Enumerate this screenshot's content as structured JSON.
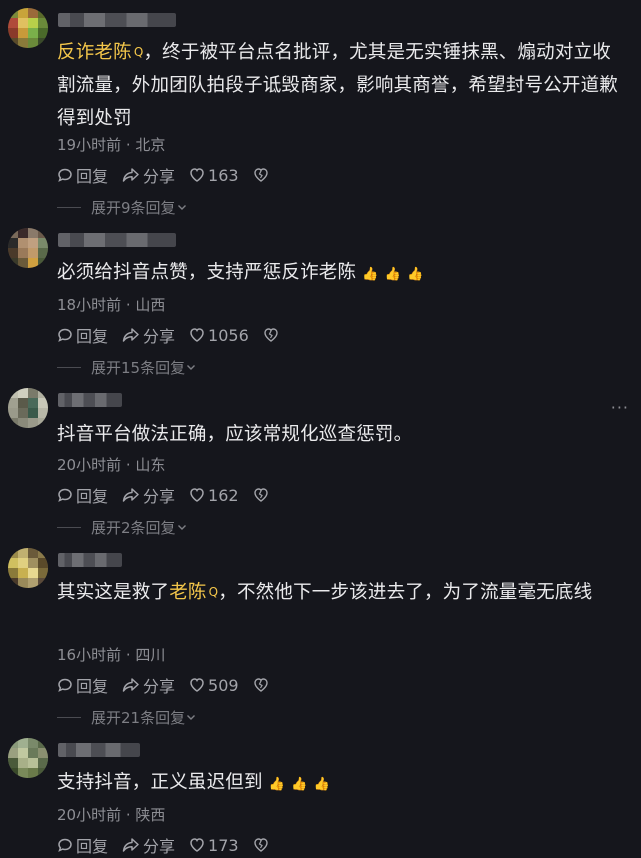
{
  "comments": [
    {
      "highlight": "反诈老陈",
      "text": "，终于被平台点名批评，尤其是无实锤抹黑、煽动对立收割流量，外加团队拍段子诋毁商家，影响其商誉，希望封号公开道歉 得到处罚",
      "time": "19小时前",
      "location": "北京",
      "reply_label": "回复",
      "share_label": "分享",
      "likes": "163",
      "expand_label": "展开9条回复"
    },
    {
      "text": "必须给抖音点赞，支持严惩反诈老陈",
      "emojis": [
        "👍",
        "👍",
        "👍"
      ],
      "time": "18小时前",
      "location": "山西",
      "reply_label": "回复",
      "share_label": "分享",
      "likes": "1056",
      "expand_label": "展开15条回复"
    },
    {
      "text": "抖音平台做法正确，应该常规化巡查惩罚。",
      "time": "20小时前",
      "location": "山东",
      "reply_label": "回复",
      "share_label": "分享",
      "likes": "162",
      "expand_label": "展开2条回复",
      "more": "···"
    },
    {
      "text_before": "其实这是救了",
      "highlight": "老陈",
      "text_after": "，不然他下一步该进去了，为了流量毫无底线",
      "time": "16小时前",
      "location": "四川",
      "reply_label": "回复",
      "share_label": "分享",
      "likes": "509",
      "expand_label": "展开21条回复"
    },
    {
      "text": "支持抖音，正义虽迟但到",
      "emojis": [
        "👍",
        "👍",
        "👍"
      ],
      "time": "20小时前",
      "location": "陕西",
      "reply_label": "回复",
      "share_label": "分享",
      "likes": "173"
    }
  ],
  "search_mark": "Q",
  "meta_separator": " · ",
  "colors": {
    "background": "#15161c",
    "highlight": "#f3c64a",
    "meta": "#8d8e94"
  }
}
